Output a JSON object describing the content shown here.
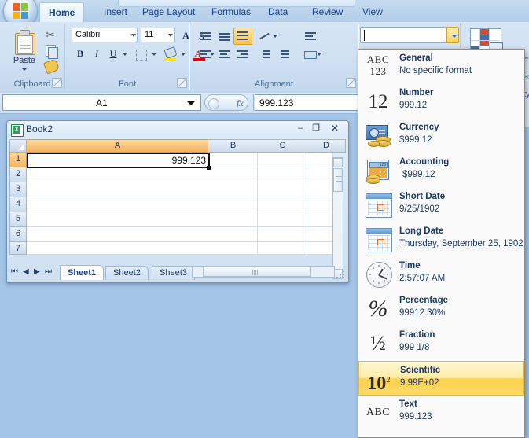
{
  "app": {
    "office_button": "office-orb",
    "ribbon_tabs": [
      {
        "label": "Home",
        "active": true
      },
      {
        "label": "Insert",
        "active": false
      },
      {
        "label": "Page Layout",
        "active": false
      },
      {
        "label": "Formulas",
        "active": false
      },
      {
        "label": "Data",
        "active": false
      },
      {
        "label": "Review",
        "active": false
      },
      {
        "label": "View",
        "active": false
      }
    ]
  },
  "ribbon": {
    "clipboard": {
      "group_label": "Clipboard",
      "paste_label": "Paste",
      "cut_label": "Cut",
      "copy_label": "Copy",
      "format_painter_label": "Format Painter"
    },
    "font": {
      "group_label": "Font",
      "font_name": "Calibri",
      "font_size": "11",
      "grow_font": "A",
      "shrink_font": "A",
      "bold": "B",
      "italic": "I",
      "underline": "U"
    },
    "alignment": {
      "group_label": "Alignment"
    },
    "number": {
      "format_value": "",
      "format_placeholder": ""
    },
    "styles": {
      "conditional_formatting": "conditional-formatting-icon"
    }
  },
  "formula_bar": {
    "name_box": "A1",
    "fx_label": "fx",
    "formula_value": "999.123"
  },
  "workbook": {
    "title": "Book2",
    "minimize": "–",
    "maximize": "❐",
    "close": "✕",
    "columns": [
      "A",
      "B",
      "C",
      "D"
    ],
    "rows": [
      "1",
      "2",
      "3",
      "4",
      "5",
      "6",
      "7"
    ],
    "selected_cell": "A1",
    "selected_value": "999.123",
    "sheet_tabs": [
      {
        "label": "Sheet1",
        "active": true
      },
      {
        "label": "Sheet2",
        "active": false
      },
      {
        "label": "Sheet3",
        "active": false
      }
    ],
    "nav_first": "⏮",
    "nav_prev": "◀",
    "nav_next": "▶",
    "nav_last": "⏭"
  },
  "number_format_menu": {
    "items": [
      {
        "icon": "abc123-icon",
        "title": "General",
        "sample": "No specific format",
        "highlighted": false
      },
      {
        "icon": "number-12-icon",
        "title": "Number",
        "sample": "999.12",
        "highlighted": false
      },
      {
        "icon": "currency-icon",
        "title": "Currency",
        "sample": "$999.12",
        "highlighted": false
      },
      {
        "icon": "accounting-icon",
        "title": "Accounting",
        "sample": "$999.12",
        "highlighted": false
      },
      {
        "icon": "calendar-icon",
        "title": "Short Date",
        "sample": "9/25/1902",
        "highlighted": false
      },
      {
        "icon": "calendar-icon",
        "title": "Long Date",
        "sample": "Thursday, September 25, 1902",
        "highlighted": false
      },
      {
        "icon": "clock-icon",
        "title": "Time",
        "sample": "2:57:07 AM",
        "highlighted": false
      },
      {
        "icon": "percent-icon",
        "title": "Percentage",
        "sample": "99912.30%",
        "highlighted": false
      },
      {
        "icon": "fraction-icon",
        "title": "Fraction",
        "sample": "999 1/8",
        "highlighted": false
      },
      {
        "icon": "scientific-icon",
        "title": "Scientific",
        "sample": "9.99E+02",
        "highlighted": true
      },
      {
        "icon": "abc-icon",
        "title": "Text",
        "sample": "999.123",
        "highlighted": false
      }
    ]
  },
  "colors": {
    "workspace_background": "#a4c4e8",
    "ribbon_background": "#cfe0f2",
    "accent_blue": "#15428b",
    "highlight_amber": "#ffd24d",
    "selection_orange": "#f5b460",
    "menu_background": "#fbfbfb"
  }
}
